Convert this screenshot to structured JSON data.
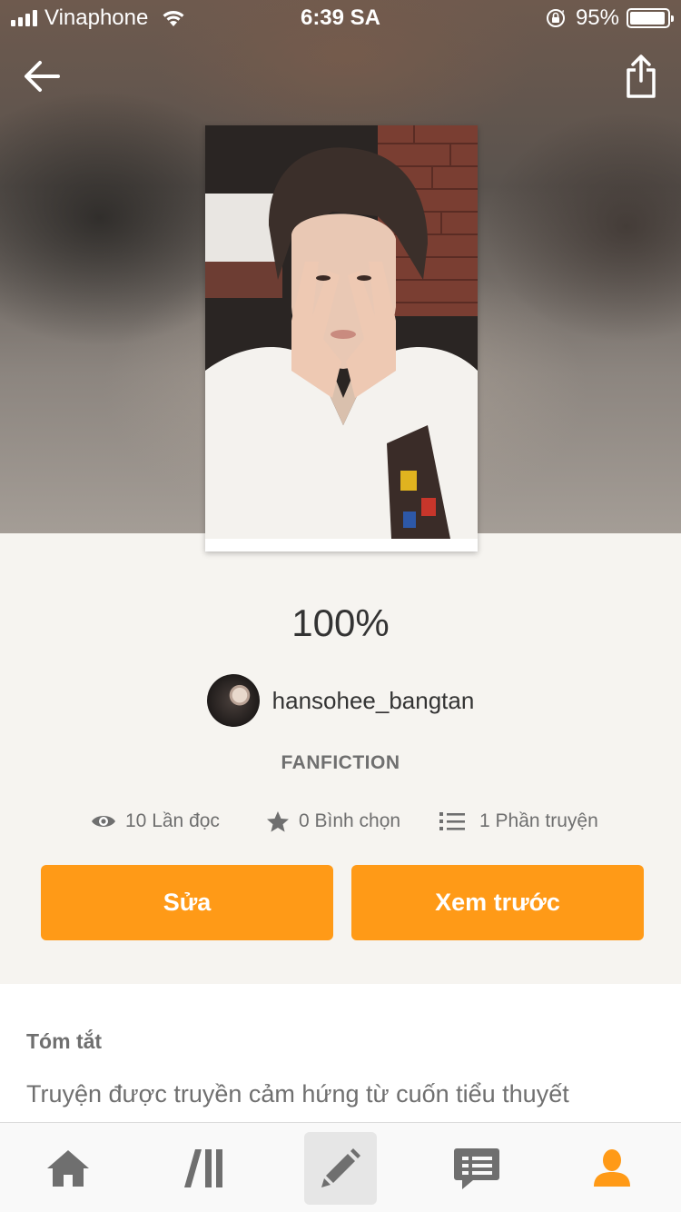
{
  "status_bar": {
    "carrier": "Vinaphone",
    "time": "6:39 SA",
    "battery": "95%",
    "battery_level": 0.95
  },
  "header": {
    "back_icon": "arrow-left-icon",
    "share_icon": "share-icon"
  },
  "story": {
    "title": "100%",
    "author": "hansohee_bangtan",
    "category": "FANFICTION",
    "stats": {
      "reads": "10 Lần đọc",
      "votes": "0 Bình chọn",
      "parts": "1 Phần truyện"
    }
  },
  "actions": {
    "edit_label": "Sửa",
    "preview_label": "Xem trước"
  },
  "summary": {
    "heading": "Tóm tắt",
    "text": "Truyện được truyền cảm hứng từ cuốn tiểu thuyết"
  },
  "tab_bar": {
    "items": [
      "home-icon",
      "library-icon",
      "write-icon",
      "messages-icon",
      "profile-icon"
    ],
    "active": "write-icon"
  },
  "colors": {
    "accent": "#ff9a17",
    "background": "#f6f4f0",
    "text_primary": "#333333",
    "text_secondary": "#6f6f6f",
    "icon_gray": "#6f6f6f"
  }
}
